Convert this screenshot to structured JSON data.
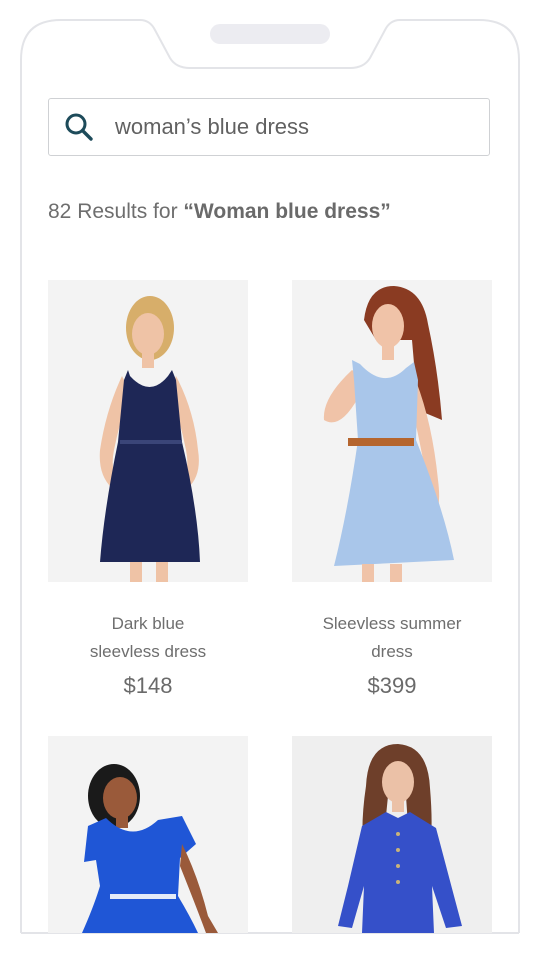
{
  "search": {
    "query": "woman’s blue dress"
  },
  "results": {
    "count": "82",
    "prefix": "Results for",
    "query": "“Woman blue dress”"
  },
  "products": [
    {
      "name_line1": "Dark blue",
      "name_line2": "sleevless dress",
      "price": "$148",
      "dress_color": "#1e2756"
    },
    {
      "name_line1": "Sleevless summer",
      "name_line2": "dress",
      "price": "$399",
      "dress_color": "#a9c6ea"
    },
    {
      "dress_color": "#1f56d6"
    },
    {
      "dress_color": "#3550c9"
    }
  ],
  "colors": {
    "icon": "#1d4b5a",
    "border": "#cfd1d4",
    "image_bg": "#f3f3f3"
  }
}
